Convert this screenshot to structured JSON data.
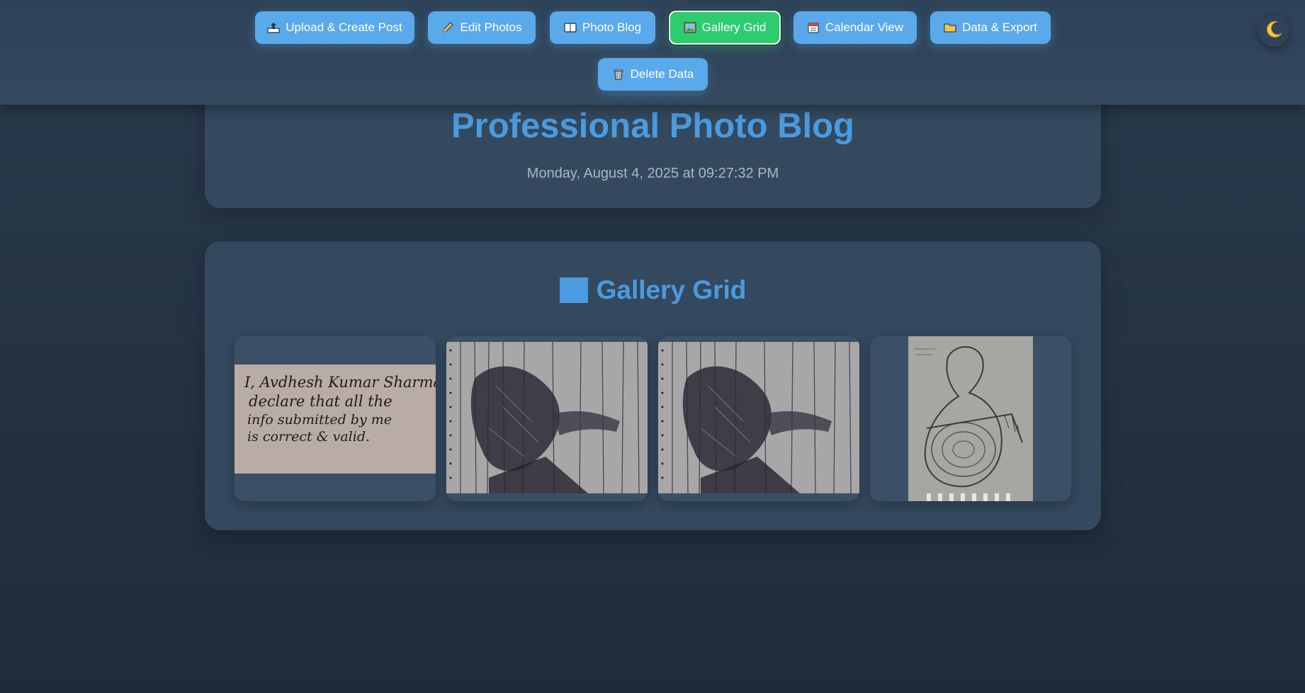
{
  "nav": {
    "buttons": [
      {
        "label": "Upload & Create Post",
        "icon": "upload-tray-icon"
      },
      {
        "label": "Edit Photos",
        "icon": "pencil-icon"
      },
      {
        "label": "Photo Blog",
        "icon": "book-icon"
      },
      {
        "label": "Gallery Grid",
        "icon": "framed-picture-icon",
        "active": true
      },
      {
        "label": "Calendar View",
        "icon": "calendar-icon"
      },
      {
        "label": "Data & Export",
        "icon": "folder-icon"
      },
      {
        "label": "Delete Data",
        "icon": "wastebasket-icon"
      }
    ],
    "theme_toggle_icon": "crescent-moon-icon"
  },
  "header": {
    "title": "Professional Photo Blog",
    "datetime": "Monday, August 4, 2025 at 09:27:32 PM"
  },
  "gallery": {
    "title": "Gallery Grid",
    "title_icon": "blue-square-icon",
    "photos": [
      {
        "kind": "handwritten-note",
        "lines": [
          "I, Avdhesh Kumar Sharma",
          "declare that all the",
          "info submitted by me",
          "is correct & valid."
        ]
      },
      {
        "kind": "ink-sketch"
      },
      {
        "kind": "ink-sketch"
      },
      {
        "kind": "pencil-sketch"
      }
    ]
  },
  "colors": {
    "accent": "#4a9be0",
    "button": "#5aa9ea",
    "active_button": "#2ecc71",
    "card": "#34495e"
  }
}
